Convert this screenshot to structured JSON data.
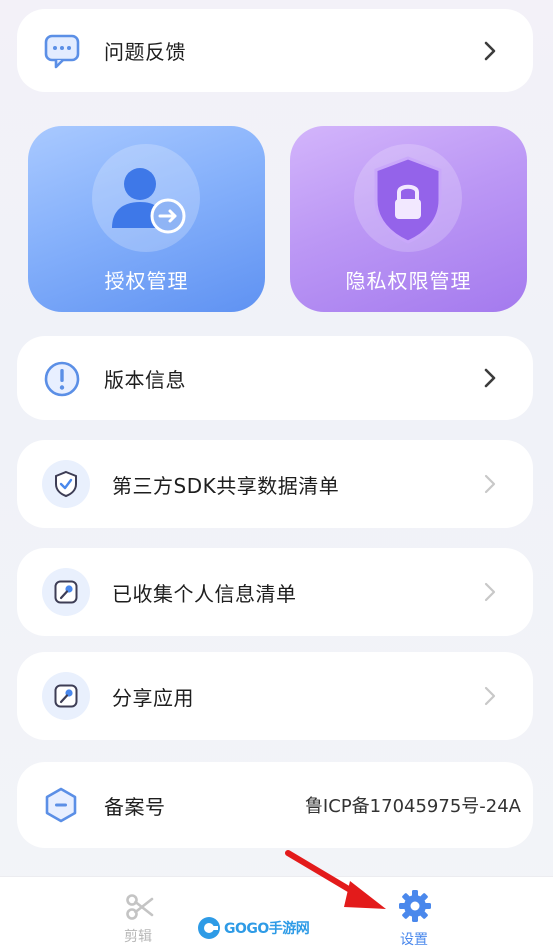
{
  "rows": {
    "feedback": {
      "label": "问题反馈"
    },
    "version": {
      "label": "版本信息"
    },
    "sdk_list": {
      "label": "第三方SDK共享数据清单"
    },
    "personal_info": {
      "label": "已收集个人信息清单"
    },
    "share_app": {
      "label": "分享应用"
    },
    "icp": {
      "label": "备案号",
      "value": "鲁ICP备17045975号-24A"
    }
  },
  "big_cards": {
    "authorization": {
      "label": "授权管理",
      "color": "#6f9ff6"
    },
    "privacy": {
      "label": "隐私权限管理",
      "color": "#b38af0"
    }
  },
  "tabbar": {
    "tabs": [
      {
        "label": "剪辑",
        "icon": "scissors-icon",
        "active": false
      },
      {
        "label": "设置",
        "icon": "gear-icon",
        "active": true
      }
    ]
  },
  "watermark": {
    "text": "GOGO手游网"
  },
  "colors": {
    "accent": "#4a88ec",
    "chevron": "#3c3c3c",
    "chevron_light": "#c8c8c8"
  }
}
